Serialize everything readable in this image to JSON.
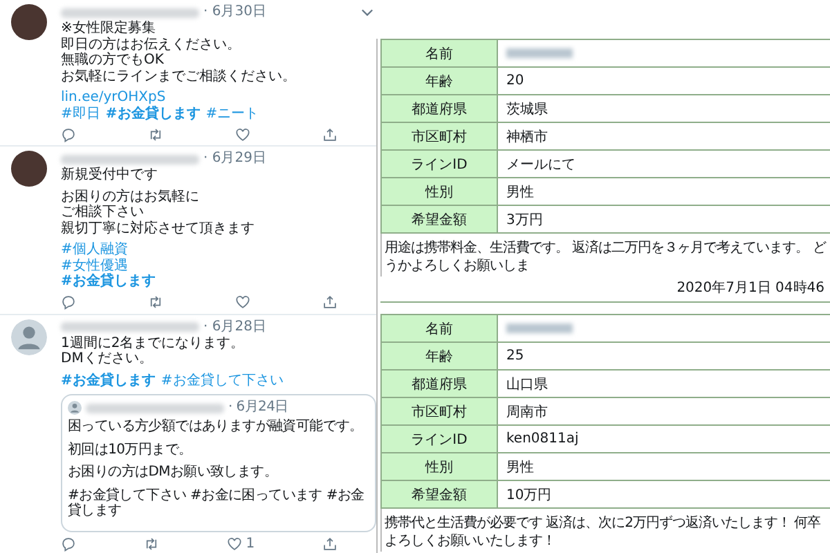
{
  "tweets": [
    {
      "avatar": {
        "kind": "photo"
      },
      "date": "· 6月30日",
      "caret": true,
      "paragraphs": [
        [
          "※女性限定募集",
          "即日の方はお伝えください。",
          "無職の方でもOK",
          "お気軽にラインまでご相談ください。"
        ]
      ],
      "link": "lin.ee/yrOHXpS",
      "tags": {
        "kind": "row",
        "items": [
          {
            "text": "#即日",
            "bold": false
          },
          {
            "text": "#お金貸します",
            "bold": true
          },
          {
            "text": "#ニート",
            "bold": false
          }
        ]
      }
    },
    {
      "avatar": {
        "kind": "photo"
      },
      "date": "· 6月29日",
      "caret": false,
      "paragraphs": [
        [
          "新規受付中です"
        ],
        [
          "お困りの方はお気軽に",
          "ご相談下さい",
          "親切丁寧に対応させて頂きます"
        ]
      ],
      "tags": {
        "kind": "column",
        "items": [
          {
            "text": "#個人融資",
            "bold": false
          },
          {
            "text": "#女性優遇",
            "bold": false
          },
          {
            "text": "#お金貸します",
            "bold": true
          }
        ]
      }
    },
    {
      "avatar": {
        "kind": "default"
      },
      "date": "· 6月28日",
      "caret": false,
      "paragraphs": [
        [
          "1週間に2名までになります。",
          "DMください。"
        ]
      ],
      "tags": {
        "kind": "row",
        "items": [
          {
            "text": "#お金貸します",
            "bold": true
          },
          {
            "text": "#お金貸して下さい",
            "bold": false
          }
        ]
      },
      "quote": {
        "date": "· 6月24日",
        "paragraphs": [
          [
            "困っている方少額ではありますが融資可能です。"
          ],
          [
            "初回は10万円まで。"
          ],
          [
            "お困りの方はDMお願い致します。"
          ],
          [
            "#お金貸して下さい #お金に困っています #お金貸します"
          ]
        ]
      },
      "likes": "1"
    }
  ],
  "forms": [
    {
      "rows": [
        {
          "label": "名前",
          "blurred": true
        },
        {
          "label": "年齢",
          "value": "20"
        },
        {
          "label": "都道府県",
          "value": "茨城県"
        },
        {
          "label": "市区町村",
          "value": "神栖市"
        },
        {
          "label": "ラインID",
          "value": "メールにて"
        },
        {
          "label": "性別",
          "value": "男性"
        },
        {
          "label": "希望金額",
          "value": "3万円"
        }
      ],
      "note": "用途は携帯料金、生活費です。 返済は二万円を３ヶ月で考えています。 どうかよろしくお願いしま",
      "date": "2020年7月1日 04時46"
    },
    {
      "rows": [
        {
          "label": "名前",
          "blurred": true
        },
        {
          "label": "年齢",
          "value": "25"
        },
        {
          "label": "都道府県",
          "value": "山口県"
        },
        {
          "label": "市区町村",
          "value": "周南市"
        },
        {
          "label": "ラインID",
          "value": "ken0811aj"
        },
        {
          "label": "性別",
          "value": "男性"
        },
        {
          "label": "希望金額",
          "value": "10万円"
        }
      ],
      "note": "携帯代と生活費が必要です 返済は、次に2万円ずつ返済いたします！ 何卒よろしくお願いいたします！"
    }
  ]
}
